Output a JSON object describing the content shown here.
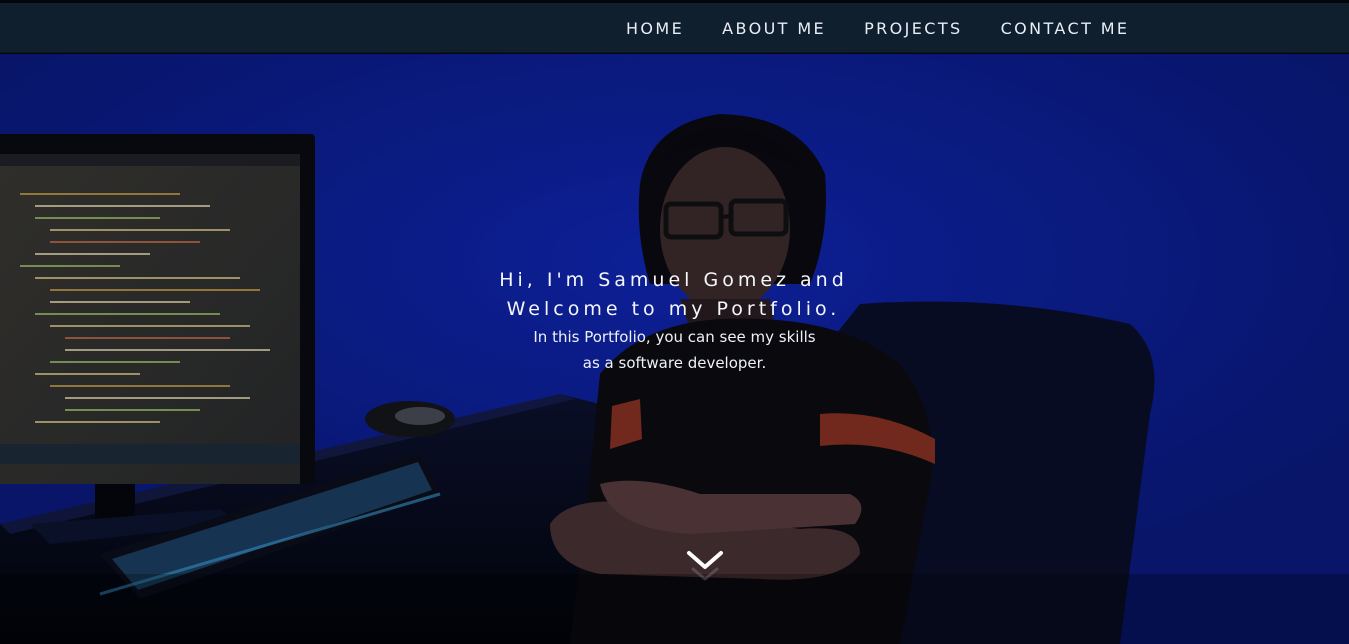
{
  "nav": {
    "items": [
      {
        "label": "HOME"
      },
      {
        "label": "ABOUT ME"
      },
      {
        "label": "PROJECTS"
      },
      {
        "label": "CONTACT ME"
      }
    ]
  },
  "hero": {
    "title_line1": "Hi, I'm Samuel Gomez and",
    "title_line2": "Welcome to my Portfolio.",
    "subtitle_line1": "In this Portfolio, you can see my skills",
    "subtitle_line2": "as a software developer.",
    "scroll_icon": "chevron-down-icon"
  },
  "colors": {
    "navbar": "#0f1f2e",
    "hero_blue": "#0e23a8",
    "text": "#f4f6fb"
  }
}
